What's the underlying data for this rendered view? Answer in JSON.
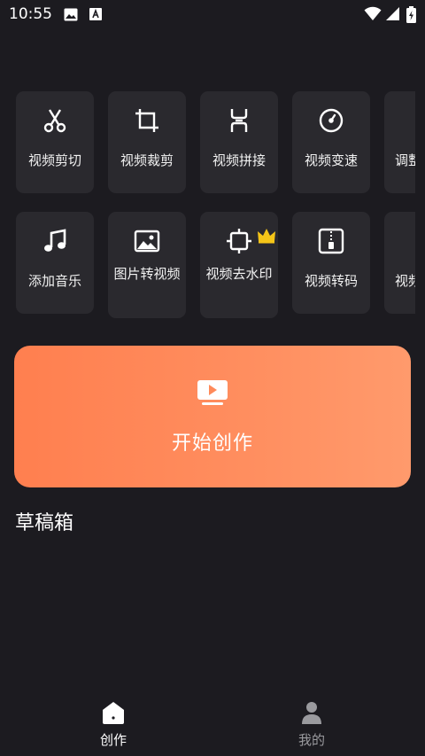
{
  "status_bar": {
    "time": "10:55"
  },
  "tools_row1": [
    {
      "label": "视频剪切",
      "icon": "scissors-icon"
    },
    {
      "label": "视频裁剪",
      "icon": "crop-icon"
    },
    {
      "label": "视频拼接",
      "icon": "merge-icon"
    },
    {
      "label": "视频变速",
      "icon": "speed-icon"
    },
    {
      "label": "调整",
      "icon": "adjust-icon"
    }
  ],
  "tools_row2": [
    {
      "label": "添加音乐",
      "icon": "music-icon"
    },
    {
      "label": "图片转视频",
      "icon": "image-icon"
    },
    {
      "label": "视频去水印",
      "icon": "watermark-icon",
      "badge": "crown-icon"
    },
    {
      "label": "视频转码",
      "icon": "zip-icon"
    },
    {
      "label": "视频",
      "icon": "video-icon"
    }
  ],
  "start_button": {
    "label": "开始创作",
    "icon": "video-play-icon",
    "color": "#ff8a5a"
  },
  "drafts": {
    "title": "草稿箱"
  },
  "bottom_nav": {
    "create": "创作",
    "mine": "我的",
    "active_color": "#ffffff",
    "inactive_color": "#9a9a9e"
  }
}
